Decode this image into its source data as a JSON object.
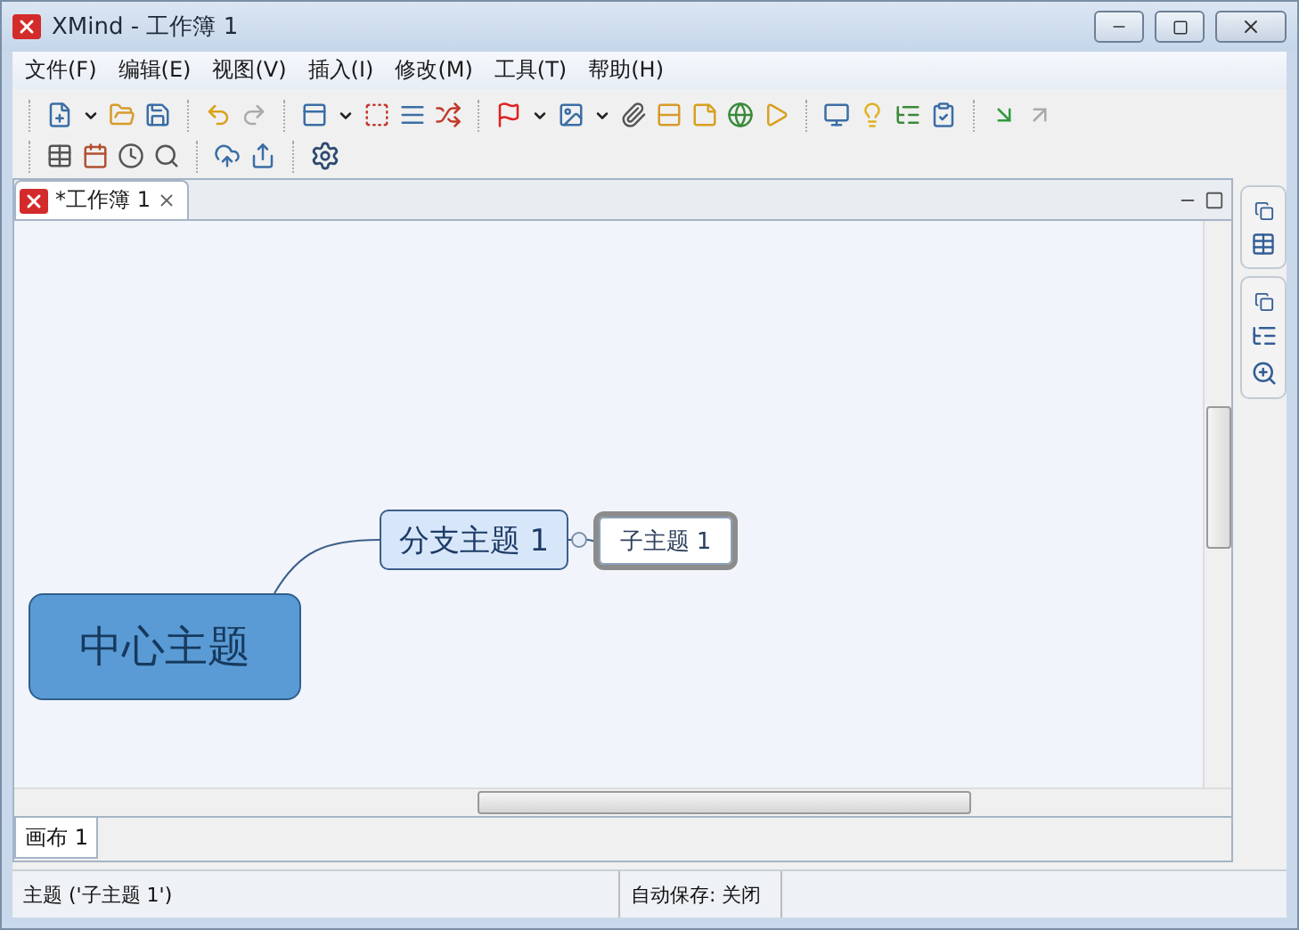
{
  "window": {
    "title": "XMind - 工作簿 1"
  },
  "menu": [
    "文件(F)",
    "编辑(E)",
    "视图(V)",
    "插入(I)",
    "修改(M)",
    "工具(T)",
    "帮助(H)"
  ],
  "editor_tab": {
    "title": "*工作簿 1"
  },
  "nodes": [
    {
      "kind": "central",
      "text": "中心主题",
      "selected": false
    },
    {
      "kind": "main",
      "text": "分支主题 1",
      "selected": false
    },
    {
      "kind": "sub",
      "text": "子主题 1",
      "selected": true
    }
  ],
  "sheet_tabs": [
    {
      "label": "画布 1",
      "selected": true
    }
  ],
  "status_bar": {
    "selection": "主题 ('子主题 1')",
    "autosave": "自动保存: 关闭"
  }
}
